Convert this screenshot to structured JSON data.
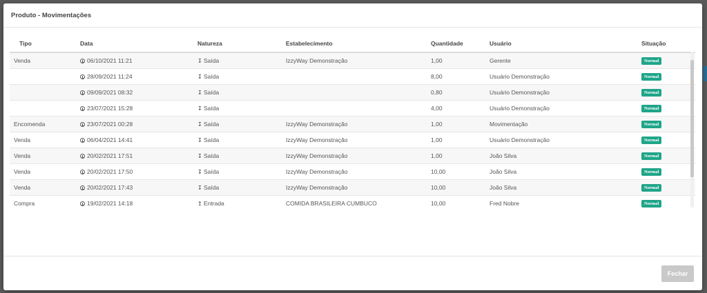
{
  "modal": {
    "title": "Produto - Movimentações",
    "close_label": "Fechar"
  },
  "table": {
    "headers": {
      "tipo": "Tipo",
      "data": "Data",
      "natureza": "Natureza",
      "estabelecimento": "Estabelecimento",
      "quantidade": "Quantidade",
      "usuario": "Usuário",
      "situacao": "Situação"
    },
    "rows": [
      {
        "tipo": "Venda",
        "data": "06/10/2021 11:21",
        "natureza_icon": "arrow-down-icon",
        "natureza": "Saída",
        "estabelecimento": "IzzyWay Demonstração",
        "quantidade": "1,00",
        "usuario": "Gerente",
        "situacao": "Normal"
      },
      {
        "tipo": "",
        "data": "28/09/2021 11:24",
        "natureza_icon": "arrow-down-icon",
        "natureza": "Saída",
        "estabelecimento": "",
        "quantidade": "8,00",
        "usuario": "Usuário Demonstração",
        "situacao": "Normal"
      },
      {
        "tipo": "",
        "data": "09/09/2021 08:32",
        "natureza_icon": "arrow-down-icon",
        "natureza": "Saída",
        "estabelecimento": "",
        "quantidade": "0,80",
        "usuario": "Usuário Demonstração",
        "situacao": "Normal"
      },
      {
        "tipo": "",
        "data": "23/07/2021 15:28",
        "natureza_icon": "arrow-down-icon",
        "natureza": "Saída",
        "estabelecimento": "",
        "quantidade": "4,00",
        "usuario": "Usuário Demonstração",
        "situacao": "Normal"
      },
      {
        "tipo": "Encomenda",
        "data": "23/07/2021 00:28",
        "natureza_icon": "arrow-down-icon",
        "natureza": "Saída",
        "estabelecimento": "IzzyWay Demonstração",
        "quantidade": "1,00",
        "usuario": "Movimentação",
        "situacao": "Normal"
      },
      {
        "tipo": "Venda",
        "data": "06/04/2021 14:41",
        "natureza_icon": "arrow-down-icon",
        "natureza": "Saída",
        "estabelecimento": "IzzyWay Demonstração",
        "quantidade": "1,00",
        "usuario": "Usuário Demonstração",
        "situacao": "Normal"
      },
      {
        "tipo": "Venda",
        "data": "20/02/2021 17:51",
        "natureza_icon": "arrow-down-icon",
        "natureza": "Saída",
        "estabelecimento": "IzzyWay Demonstração",
        "quantidade": "1,00",
        "usuario": "João Silva",
        "situacao": "Normal"
      },
      {
        "tipo": "Venda",
        "data": "20/02/2021 17:50",
        "natureza_icon": "arrow-down-icon",
        "natureza": "Saída",
        "estabelecimento": "IzzyWay Demonstração",
        "quantidade": "10,00",
        "usuario": "João Silva",
        "situacao": "Normal"
      },
      {
        "tipo": "Venda",
        "data": "20/02/2021 17:43",
        "natureza_icon": "arrow-down-icon",
        "natureza": "Saída",
        "estabelecimento": "IzzyWay Demonstração",
        "quantidade": "10,00",
        "usuario": "João Silva",
        "situacao": "Normal"
      },
      {
        "tipo": "Compra",
        "data": "19/02/2021 14:18",
        "natureza_icon": "arrow-up-icon",
        "natureza": "Entrada",
        "estabelecimento": "COMIDA BRASILEIRA CUMBUCO",
        "quantidade": "10,00",
        "usuario": "Fred Nobre",
        "situacao": "Normal"
      }
    ]
  },
  "colors": {
    "badge_normal": "#1fa589",
    "button_disabled": "#c9c9c9",
    "backdrop": "#5b5b5b"
  }
}
